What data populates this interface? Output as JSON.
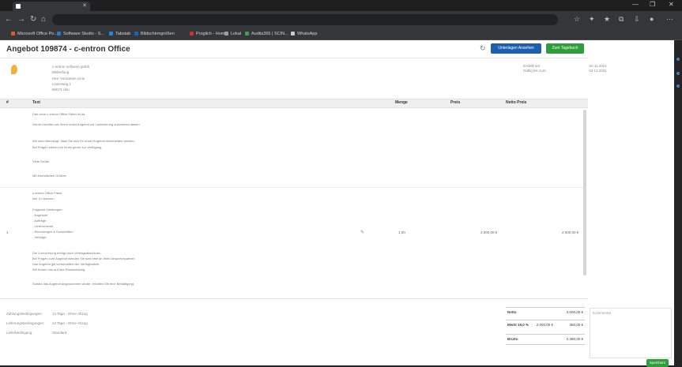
{
  "browser": {
    "tab_title": "",
    "url_host": "",
    "url_rest": "",
    "bookmarks": [
      {
        "label": "Microsoft Office Po...",
        "color": "#e25822"
      },
      {
        "label": "Software Studio - S...",
        "color": "#2b7bd6"
      },
      {
        "label": "Tabstab",
        "color": "#1e88e5"
      },
      {
        "label": "Bildschirmgrößen",
        "color": "#1565c0"
      },
      {
        "label": "Proglich - Home",
        "color": "#d32f2f"
      },
      {
        "label": "Lokal",
        "color": "#9e9e9e"
      },
      {
        "label": "Audits365 | SCIN...",
        "color": "#43a047"
      },
      {
        "label": "WhatsApp",
        "color": "#cccccc"
      }
    ]
  },
  "header": {
    "title": "Angebot 109874 - c-entron Office",
    "print_label": "Unterlagen Ansehen",
    "accept_label": "Zum Tagebuch"
  },
  "sender": {
    "logo_text": "",
    "address_lines": [
      "c-entron software gmbh",
      "Bildreifung",
      "Herr Vornamen Linie",
      "Linienweg 1",
      "89073 Ulm"
    ]
  },
  "meta": {
    "rows": [
      {
        "label": "Erstellt am:",
        "value": "03.11.2021"
      },
      {
        "label": "Gültig bis zum:",
        "value": "03.12.2021"
      }
    ]
  },
  "table": {
    "columns": [
      "#",
      "Text",
      "Menge",
      "Preis",
      "Netto Preis"
    ],
    "intro_lines": [
      "Das neue c-entron Office Paket ist da.",
      "Gerne möchten wir Ihnen unser Angebot zur Lizenzierung zukommen lassen.",
      "Wir sind überzeugt, dass Sie sich für unser Angebot entscheiden werden.",
      "Bei Fragen stehen wir Ihnen gerne zur Verfügung.",
      "Viele Grüße",
      "Mit freundlichen Grüßen"
    ],
    "item": {
      "number": "1",
      "lines": [
        "c-entron Office Paket",
        "inkl. 5 Lizenzen",
        "Folgende Leistungen:",
        "- Angebote",
        "- Aufträge",
        "- Lieferscheine",
        "- Rechnungen & Gutschriften",
        "- Verträge",
        "Die Lizenzierung erfolgt nach Vertragsabschluss.",
        "Bei Fragen zum Angebot wenden Sie sich bitte an Ihren Ansprechpartner.",
        "Das Angebot gilt vorbehaltlich der Verfügbarkeit.",
        "Wir freuen uns auf Ihre Rückmeldung.",
        "Sobald das Angebot angenommen wurde, erhalten Sie eine Bestätigung."
      ],
      "qty": "1,00",
      "price": "2.000,00 €",
      "net": "2.000,00 €"
    }
  },
  "footer": {
    "rows": [
      {
        "label": "Zahlungsbedingungen:",
        "value": "14 Tage - Ohne Abzug"
      },
      {
        "label": "Lieferungsbedingungen:",
        "value": "14 Tage - Ohne Abzug"
      },
      {
        "label": "Lieferbedingung:",
        "value": "Standard"
      }
    ],
    "totals": [
      {
        "label": "Netto",
        "value": "2.000,00 €",
        "pct": ""
      },
      {
        "label": "MwSt 19,0 %",
        "value": "380,00 €",
        "pct": "2.000,00 €"
      },
      {
        "label": "Brutto",
        "value": "2.380,00 €",
        "pct": ""
      }
    ],
    "notes_placeholder": "Kommentar",
    "save_label": "Speichern"
  }
}
